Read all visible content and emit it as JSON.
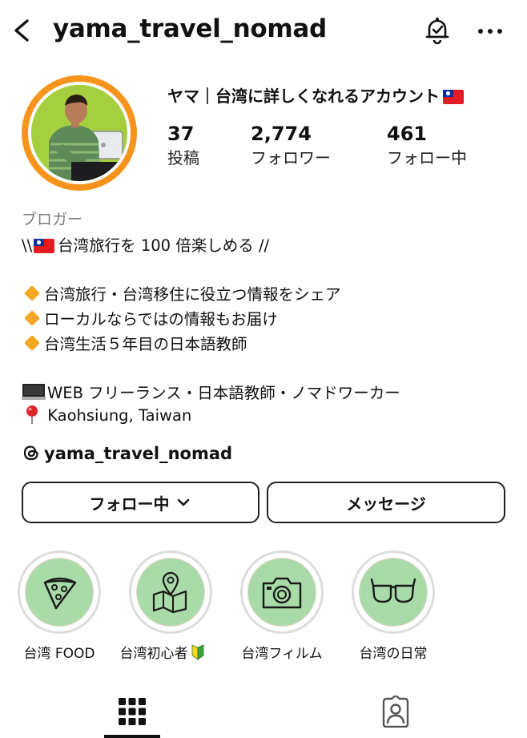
{
  "header": {
    "username": "yama_travel_nomad",
    "back_icon": "chevron-left-icon",
    "notification_icon": "bell-check-icon",
    "more_icon": "more-horizontal-icon"
  },
  "profile": {
    "display_name": "ヤマ｜台湾に詳しくなれるアカウント",
    "stats": [
      {
        "value": "37",
        "label": "投稿"
      },
      {
        "value": "2,774",
        "label": "フォロワー"
      },
      {
        "value": "461",
        "label": "フォロー中"
      }
    ],
    "category": "ブロガー",
    "bio": {
      "line1_prefix": "\\\\",
      "line1_text": "台湾旅行を 100 倍楽しめる //",
      "bullets": [
        "台湾旅行・台湾移住に役立つ情報をシェア",
        "ローカルならではの情報もお届け",
        "台湾生活５年目の日本語教師"
      ],
      "work": "WEB フリーランス・日本語教師・ノマドワーカー",
      "location": " Kaohsiung, Taiwan"
    },
    "threads_handle": "yama_travel_nomad",
    "ring_color": "#f7941d"
  },
  "actions": {
    "follow_label": "フォロー中",
    "message_label": "メッセージ"
  },
  "highlights": [
    {
      "label": "台湾 FOOD",
      "icon": "pizza-slice-icon"
    },
    {
      "label": "台湾初心者",
      "icon": "map-pin-icon"
    },
    {
      "label": "台湾フィルム",
      "icon": "camera-icon"
    },
    {
      "label": "台湾の日常",
      "icon": "sunglasses-icon"
    }
  ],
  "tabs": [
    {
      "name": "grid",
      "icon": "grid-icon"
    },
    {
      "name": "tagged",
      "icon": "tagged-person-icon"
    }
  ],
  "colors": {
    "highlight_fill": "#a8dba8",
    "bullet_diamond": "#f5a623"
  }
}
